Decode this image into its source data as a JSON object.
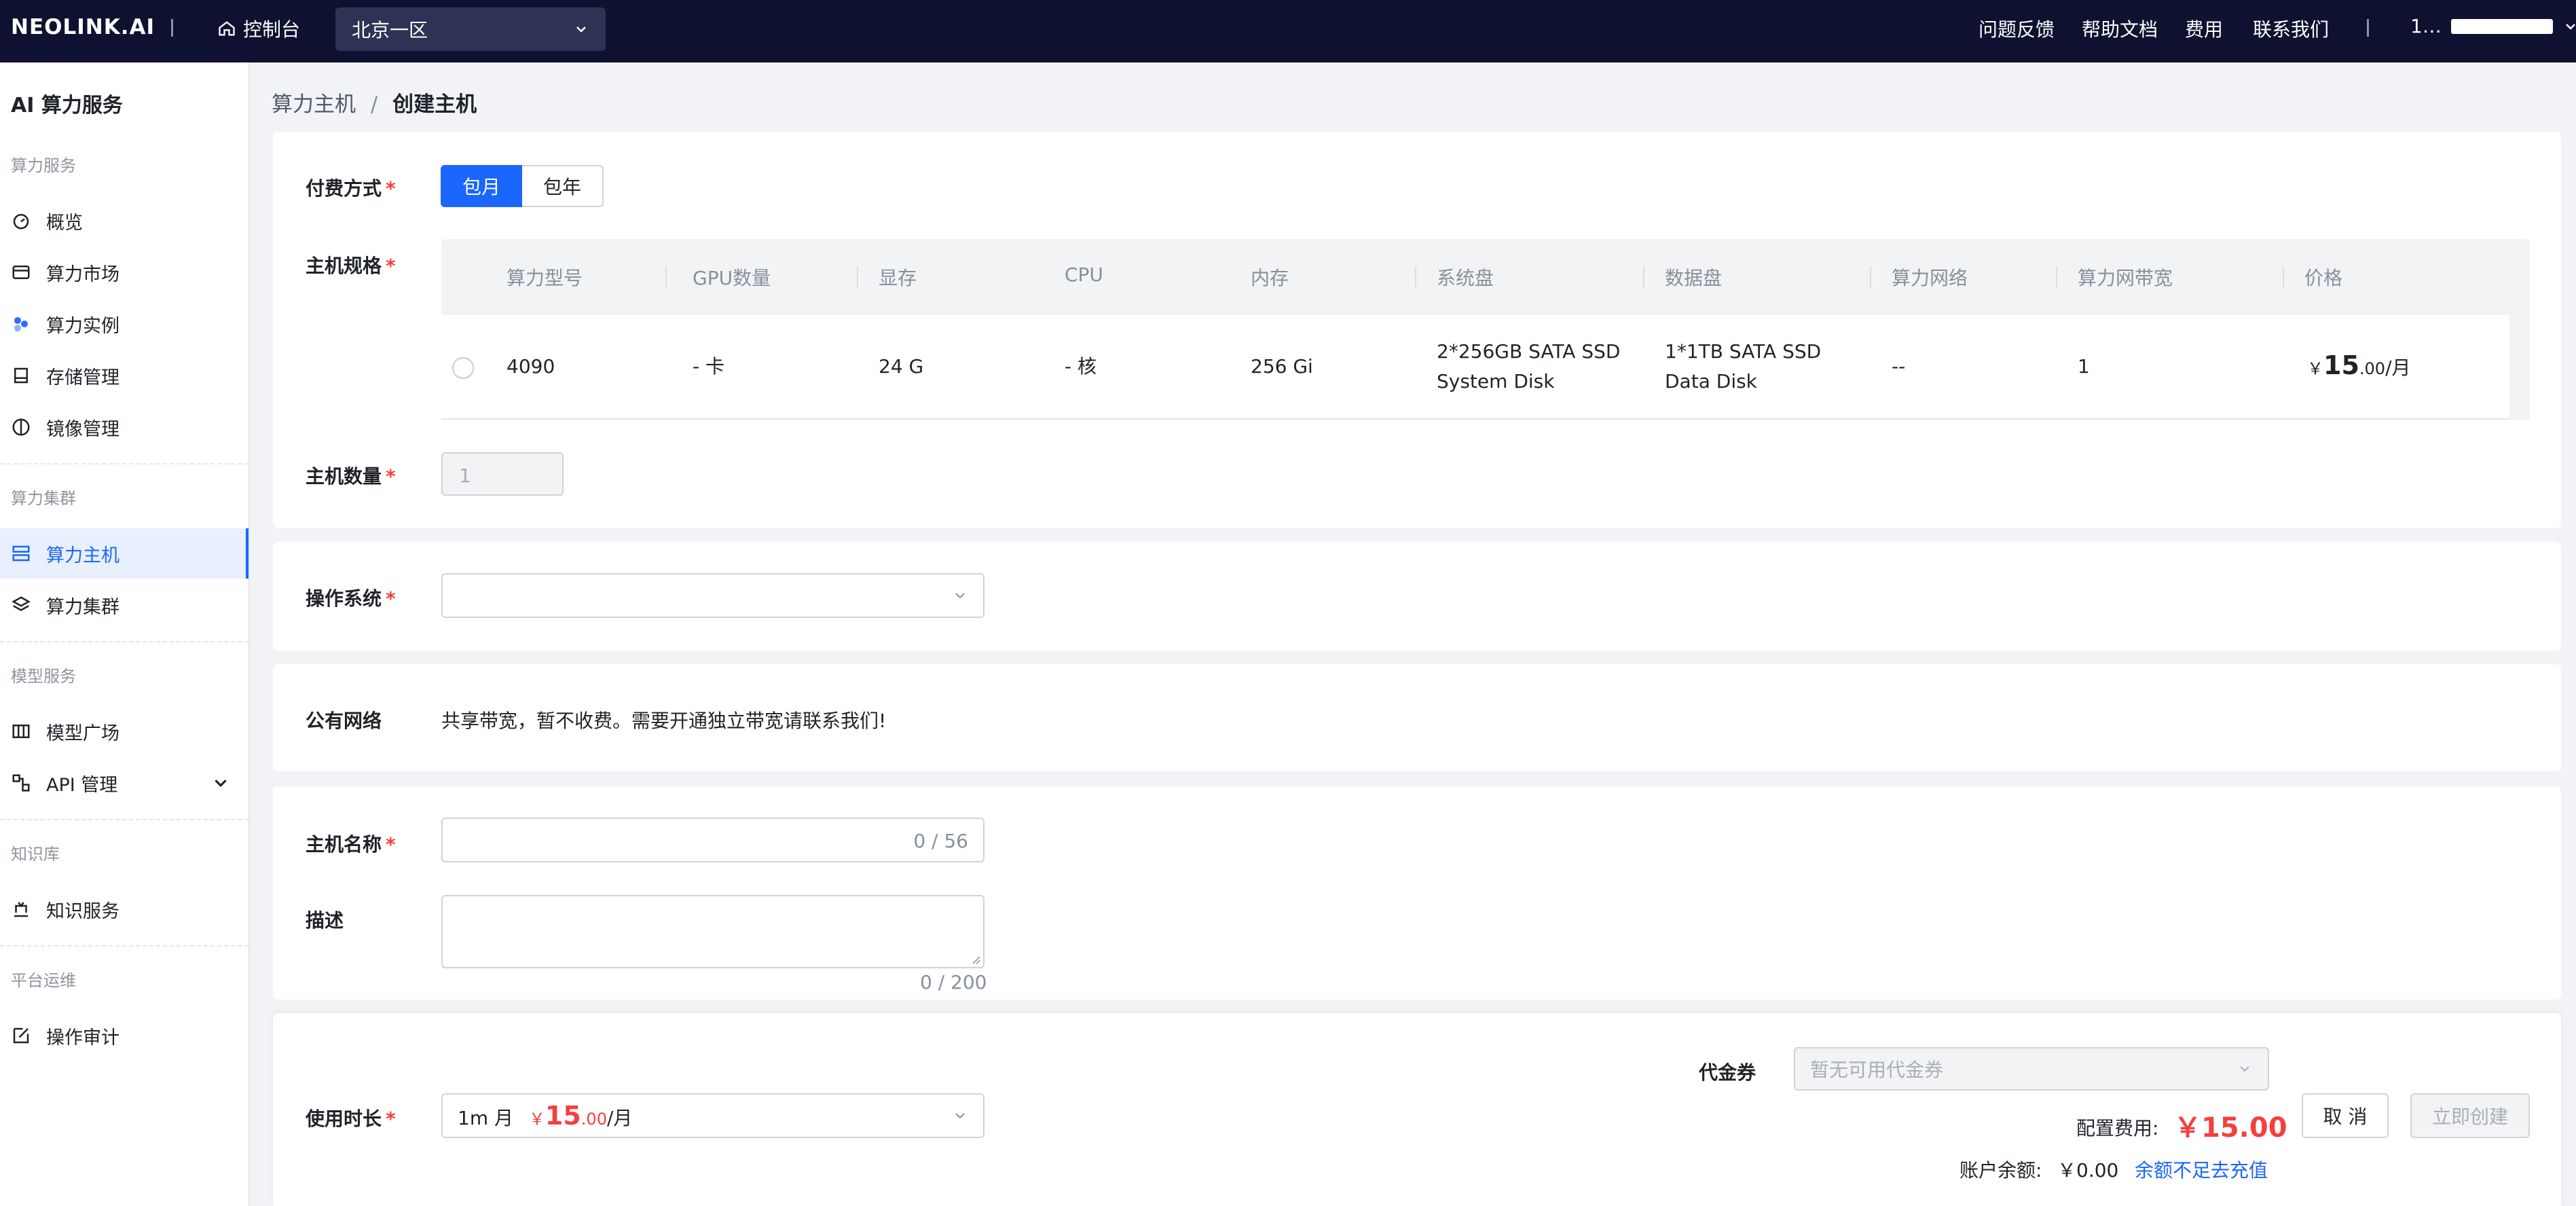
{
  "topbar": {
    "logo": "NEOLINK.AI",
    "console": "控制台",
    "region": "北京一区",
    "nav": [
      "问题反馈",
      "帮助文档",
      "费用",
      "联系我们"
    ],
    "user": "1…"
  },
  "sidebar": {
    "title": "AI 算力服务",
    "groups": [
      "算力服务",
      "算力集群",
      "模型服务",
      "知识库",
      "平台运维"
    ],
    "items": [
      "概览",
      "算力市场",
      "算力实例",
      "存储管理",
      "镜像管理",
      "算力主机",
      "算力集群",
      "模型广场",
      "API 管理",
      "知识服务",
      "操作审计"
    ],
    "active": "算力主机"
  },
  "breadcrumb": {
    "parent": "算力主机",
    "sep": "/",
    "current": "创建主机"
  },
  "billing": {
    "label": "付费方式",
    "options": [
      "包月",
      "包年"
    ],
    "selected": "包月"
  },
  "spec": {
    "label": "主机规格",
    "columns": [
      "算力型号",
      "GPU数量",
      "显存",
      "CPU",
      "内存",
      "系统盘",
      "数据盘",
      "算力网络",
      "算力网带宽",
      "价格"
    ],
    "row": {
      "model": "4090",
      "gpu": "- 卡",
      "vram": "24 G",
      "cpu": "- 核",
      "mem": "256 Gi",
      "sysdisk_1": "2*256GB SATA SSD",
      "sysdisk_2": "System Disk",
      "datadisk_1": "1*1TB SATA SSD",
      "datadisk_2": "Data Disk",
      "network": "--",
      "bandwidth": "1",
      "price_symbol": "￥",
      "price_int": "15",
      "price_dec": ".00",
      "price_unit": "/月"
    }
  },
  "quantity": {
    "label": "主机数量",
    "value": "1"
  },
  "os": {
    "label": "操作系统",
    "value": ""
  },
  "public_net": {
    "label": "公有网络",
    "text": "共享带宽，暂不收费。需要开通独立带宽请联系我们!"
  },
  "host_name": {
    "label": "主机名称",
    "counter": "0 / 56"
  },
  "desc": {
    "label": "描述",
    "counter": "0 / 200"
  },
  "duration": {
    "label": "使用时长",
    "value": "1m 月",
    "price_symbol": "￥",
    "price_int": "15",
    "price_dec": ".00",
    "price_unit": "/月"
  },
  "voucher": {
    "label": "代金券",
    "placeholder": "暂无可用代金券"
  },
  "fee": {
    "label": "配置费用:",
    "value": "￥15.00"
  },
  "balance": {
    "label": "账户余额:",
    "value": "￥0.00",
    "link": "余额不足去充值"
  },
  "actions": {
    "cancel": "取 消",
    "create": "立即创建"
  },
  "colors": {
    "primary": "#1a66ff",
    "danger": "#f53f3f",
    "topbar": "#0e1230"
  }
}
